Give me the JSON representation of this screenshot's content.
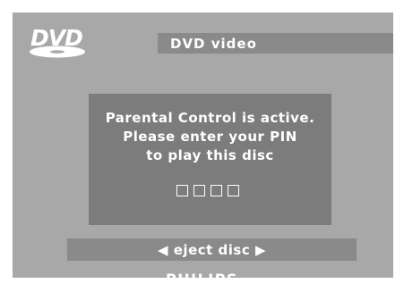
{
  "header": {
    "logo": "DVD",
    "logo_icon": "dvd-logo-icon",
    "title": "DVD video"
  },
  "dialog": {
    "line1": "Parental Control is active.",
    "line2": "Please enter your PIN",
    "line3": "to play this disc",
    "pin_placeholder_glyph": "□",
    "pin_digits": 4
  },
  "eject": {
    "left_icon": "triangle-left-icon",
    "right_icon": "triangle-right-icon",
    "label_full": "◀ eject disc ▶"
  },
  "footer": {
    "brand": "PHILIPS"
  },
  "colors": {
    "frame": "#a8a8a8",
    "dialog": "#7c7c7c",
    "bar": "#8a8a8a",
    "text": "#ffffff"
  }
}
